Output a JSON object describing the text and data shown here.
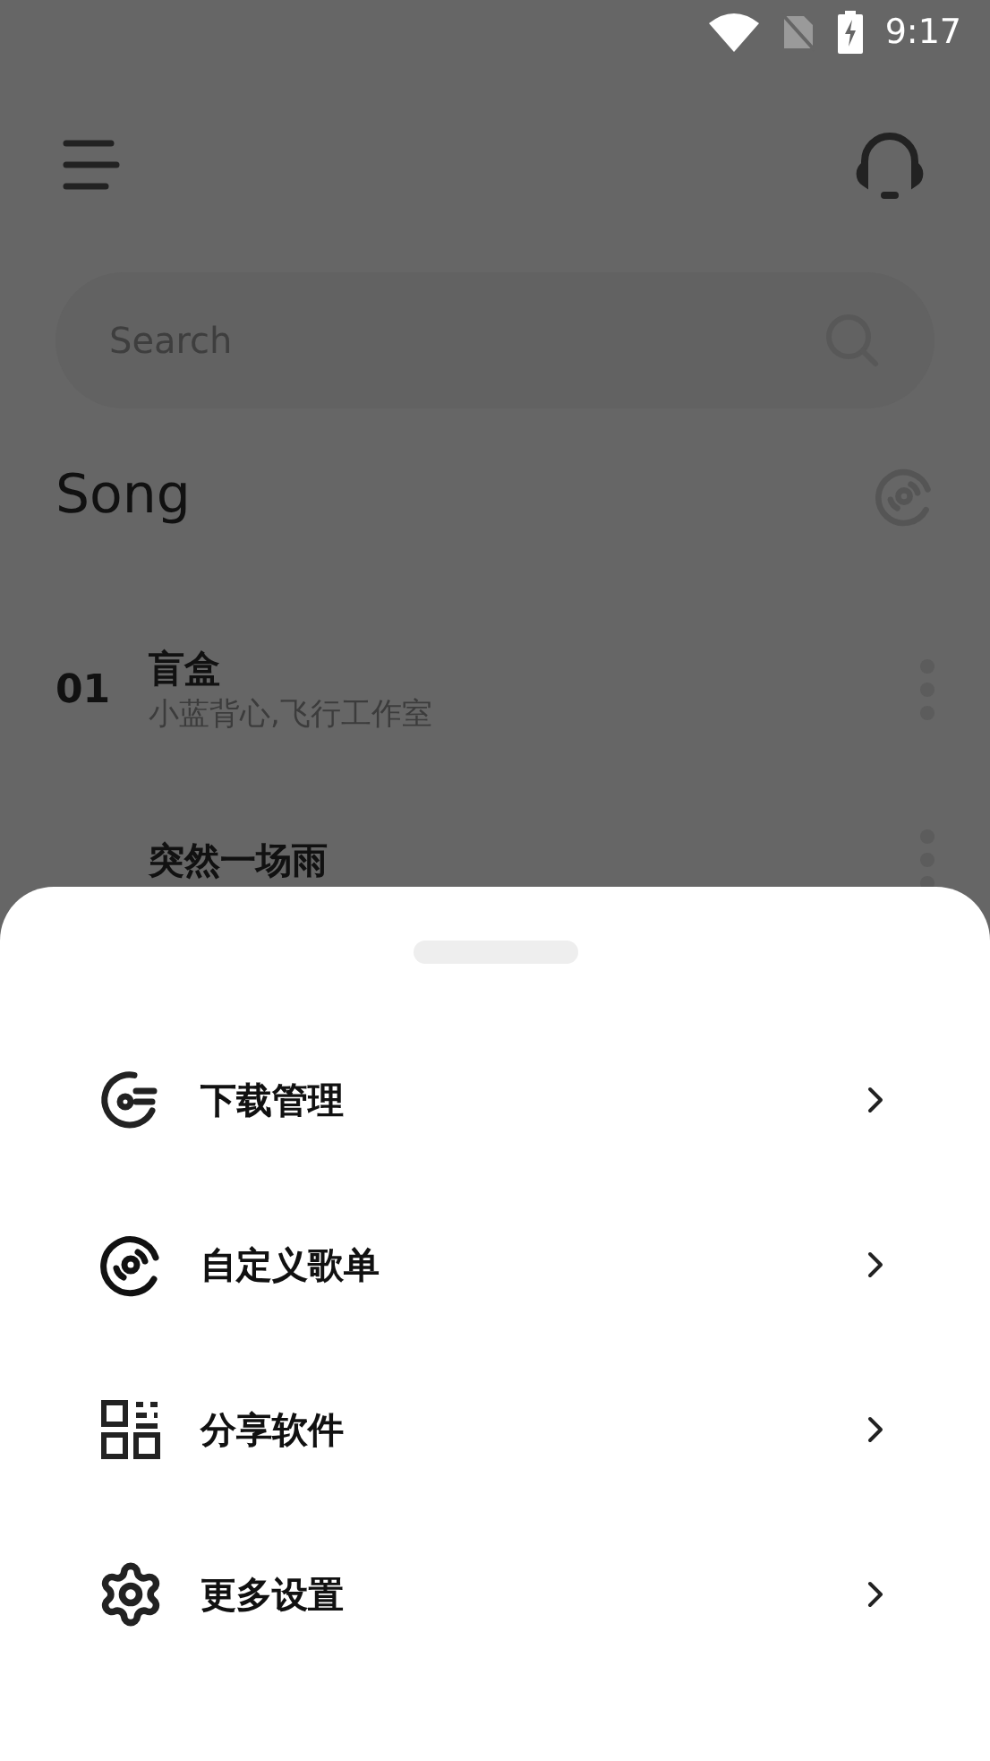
{
  "status_bar": {
    "time": "9:17"
  },
  "search": {
    "placeholder": "Search"
  },
  "section": {
    "title": "Song"
  },
  "songs": [
    {
      "number": "01",
      "title": "盲盒",
      "artist": "小蓝背心,飞行工作室"
    },
    {
      "title": "突然一场雨"
    }
  ],
  "sheet": {
    "items": [
      {
        "kind": "download",
        "label": "下载管理"
      },
      {
        "kind": "disc",
        "label": "自定义歌单"
      },
      {
        "kind": "qr",
        "label": "分享软件"
      },
      {
        "kind": "gear",
        "label": "更多设置"
      }
    ]
  }
}
